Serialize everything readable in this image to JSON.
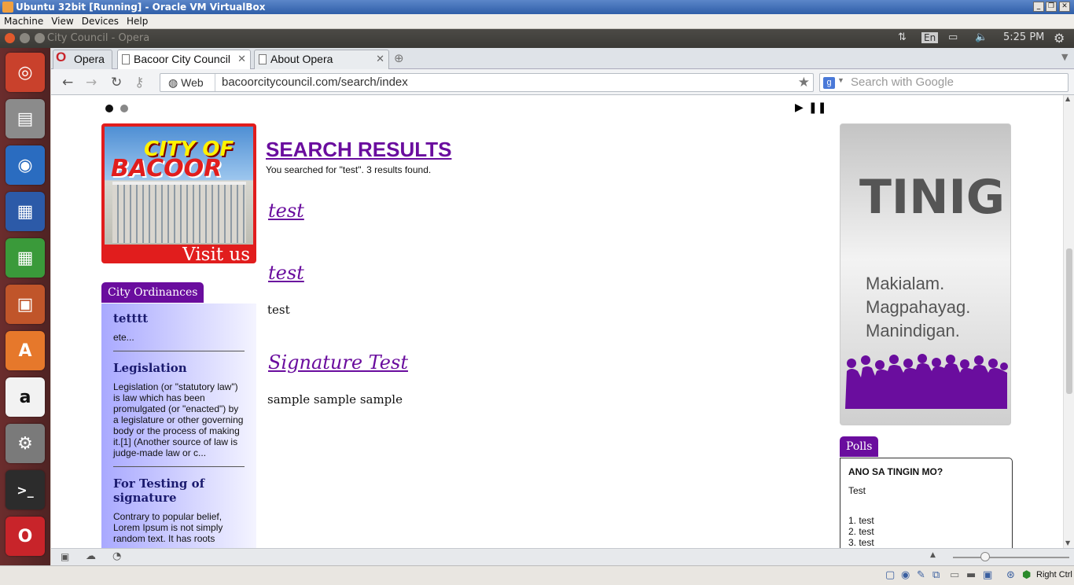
{
  "vbox": {
    "title": "Ubuntu 32bit [Running] - Oracle VM VirtualBox",
    "menu": [
      "Machine",
      "View",
      "Devices",
      "Help"
    ],
    "host_key": "Right Ctrl"
  },
  "panel": {
    "window_title": "City Council - Opera",
    "lang": "En",
    "time": "5:25 PM"
  },
  "launcher": [
    "ubuntu-dash-icon",
    "files-icon",
    "firefox-icon",
    "writer-icon",
    "calc-icon",
    "impress-icon",
    "software-center-icon",
    "amazon-icon",
    "system-settings-icon",
    "terminal-icon",
    "opera-icon"
  ],
  "opera": {
    "menu_label": "Opera",
    "tabs": [
      {
        "label": "Bacoor City Council",
        "active": true
      },
      {
        "label": "About Opera",
        "active": false
      }
    ],
    "address": {
      "scheme_label": "Web",
      "url": "bacoorcitycouncil.com/search/index"
    },
    "search_placeholder": "Search with Google"
  },
  "page": {
    "banner": {
      "line1": "CITY OF",
      "line2": "BACOOR",
      "visit": "Visit us"
    },
    "ordinances": {
      "tab": "City Ordinances",
      "items": [
        {
          "title": "tetttt",
          "excerpt": "ete..."
        },
        {
          "title": "Legislation",
          "excerpt": "Legislation (or \"statutory law\") is law which has been promulgated (or \"enacted\") by a legislature or other governing body or the process of making it.[1] (Another source of law is judge-made law or c..."
        },
        {
          "title": "For Testing of signature",
          "excerpt": "Contrary to popular belief, Lorem Ipsum is not simply random text. It has roots"
        }
      ]
    },
    "search": {
      "title": "SEARCH RESULTS",
      "summary": "You searched for \"test\". 3 results found.",
      "results": [
        {
          "title": "test",
          "text": ""
        },
        {
          "title": "test",
          "text": "test"
        },
        {
          "title": "Signature Test",
          "text": "sample sample sample"
        }
      ]
    },
    "tinig": {
      "title": "TINIG",
      "lines": [
        "Makialam.",
        "Magpahayag.",
        "Manindigan."
      ]
    },
    "polls": {
      "tab": "Polls",
      "question": "ANO SA TINGIN MO?",
      "subtitle": "Test",
      "options": [
        "1. test",
        "2. test",
        "3. test"
      ]
    }
  }
}
